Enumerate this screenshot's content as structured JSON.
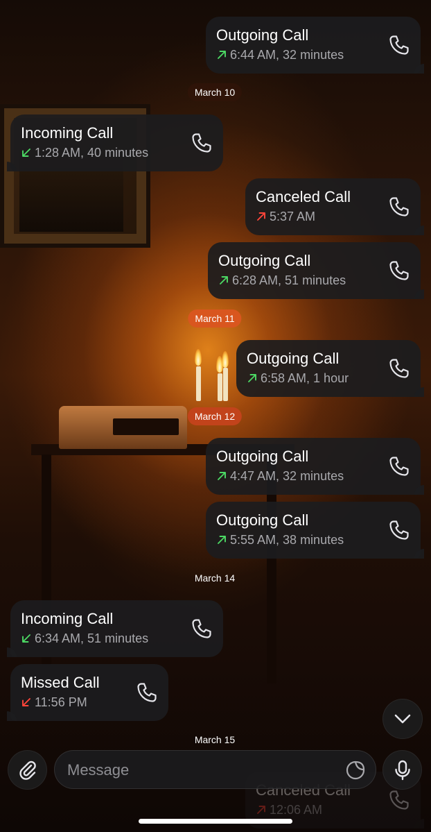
{
  "colors": {
    "bubble": "#1c1c1e",
    "secondary_text": "#a9a9ad",
    "arrow_green": "#4cd964",
    "arrow_red": "#ff453a"
  },
  "messages": [
    {
      "title": "Outgoing Call",
      "detail": "6:44 AM, 32 minutes",
      "direction": "outgoing",
      "status": "answered",
      "icon": "arrow-up-right-icon"
    },
    {
      "date": "March 10"
    },
    {
      "title": "Incoming Call",
      "detail": "1:28 AM, 40 minutes",
      "direction": "incoming",
      "status": "answered",
      "icon": "arrow-down-left-icon"
    },
    {
      "title": "Canceled Call",
      "detail": "5:37 AM",
      "direction": "outgoing",
      "status": "canceled",
      "icon": "arrow-up-right-icon"
    },
    {
      "title": "Outgoing Call",
      "detail": "6:28 AM, 51 minutes",
      "direction": "outgoing",
      "status": "answered",
      "icon": "arrow-up-right-icon"
    },
    {
      "date": "March 11"
    },
    {
      "title": "Outgoing Call",
      "detail": "6:58 AM, 1 hour",
      "direction": "outgoing",
      "status": "answered",
      "icon": "arrow-up-right-icon"
    },
    {
      "date": "March 12"
    },
    {
      "title": "Outgoing Call",
      "detail": "4:47 AM, 32 minutes",
      "direction": "outgoing",
      "status": "answered",
      "icon": "arrow-up-right-icon"
    },
    {
      "title": "Outgoing Call",
      "detail": "5:55 AM, 38 minutes",
      "direction": "outgoing",
      "status": "answered",
      "icon": "arrow-up-right-icon"
    },
    {
      "date": "March 14"
    },
    {
      "title": "Incoming Call",
      "detail": "6:34 AM, 51 minutes",
      "direction": "incoming",
      "status": "answered",
      "icon": "arrow-down-left-icon"
    },
    {
      "title": "Missed Call",
      "detail": "11:56 PM",
      "direction": "incoming",
      "status": "missed",
      "icon": "arrow-down-left-icon"
    },
    {
      "date": "March 15"
    },
    {
      "title": "Canceled Call",
      "detail": "12:06 AM",
      "direction": "outgoing",
      "status": "canceled",
      "icon": "arrow-up-right-icon"
    }
  ],
  "composer": {
    "placeholder": "Message",
    "attach_icon": "paperclip-icon",
    "sticker_icon": "sticker-icon",
    "mic_icon": "microphone-icon"
  },
  "scroll_down_icon": "chevron-down-icon",
  "call_icon": "phone-icon"
}
